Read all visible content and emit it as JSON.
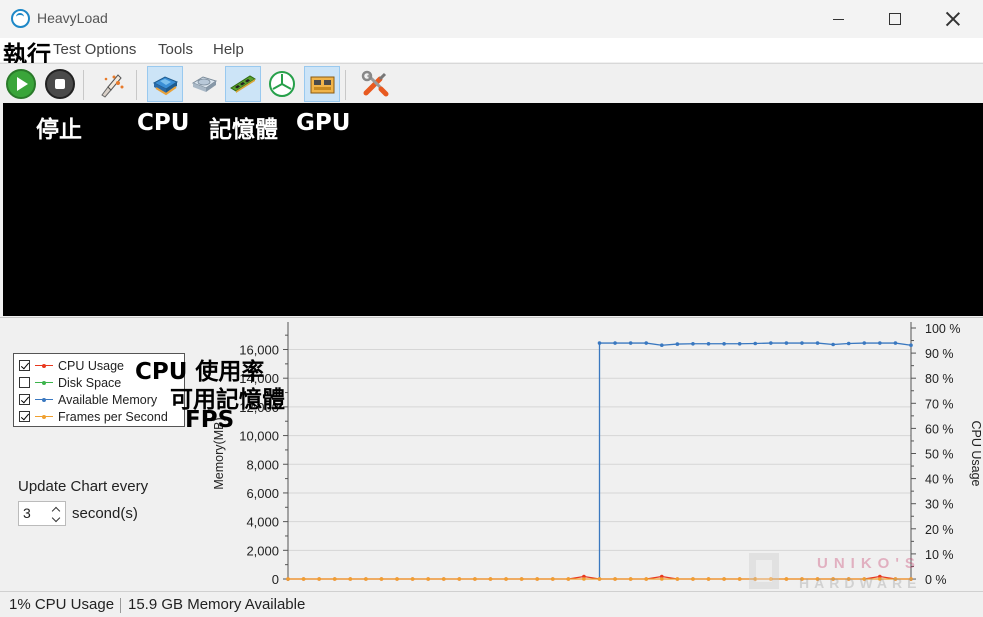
{
  "window": {
    "title": "HeavyLoad"
  },
  "menu": {
    "items": [
      "Test Options",
      "Tools",
      "Help"
    ]
  },
  "annotations": {
    "run": "執行",
    "stop": "停止",
    "cpu": "CPU",
    "memory": "記憶體",
    "gpu": "GPU",
    "cpu_usage": "CPU 使用率",
    "available_memory": "可用記憶體",
    "fps": "FPS"
  },
  "toolbar": {
    "buttons": [
      {
        "name": "start-icon",
        "state": "normal"
      },
      {
        "name": "stop-icon",
        "state": "normal"
      },
      {
        "name": "brush-icon",
        "state": "normal"
      },
      {
        "name": "cpu-chip-icon",
        "state": "active"
      },
      {
        "name": "disk-drive-icon",
        "state": "normal"
      },
      {
        "name": "memory-module-icon",
        "state": "active"
      },
      {
        "name": "pie-chart-icon",
        "state": "normal"
      },
      {
        "name": "gpu-card-icon",
        "state": "active"
      },
      {
        "name": "tools-icon",
        "state": "normal"
      }
    ]
  },
  "legend": {
    "items": [
      {
        "label": "CPU Usage",
        "checked": true,
        "color": "#e8391f"
      },
      {
        "label": "Disk Space",
        "checked": false,
        "color": "#3cb44b"
      },
      {
        "label": "Available Memory",
        "checked": true,
        "color": "#3a78c0"
      },
      {
        "label": "Frames per Second",
        "checked": true,
        "color": "#f0a030"
      }
    ]
  },
  "update": {
    "label": "Update Chart every",
    "value": "3",
    "unit": "second(s)"
  },
  "chart_data": {
    "type": "line",
    "left_axis": {
      "label": "Memory(MB)",
      "ticks": [
        "0",
        "2,000",
        "4,000",
        "6,000",
        "8,000",
        "10,000",
        "12,000",
        "14,000",
        "16,000"
      ],
      "range": [
        0,
        17500
      ]
    },
    "right_axis": {
      "label": "CPU Usage",
      "ticks": [
        "0 %",
        "10 %",
        "20 %",
        "30 %",
        "40 %",
        "50 %",
        "60 %",
        "70 %",
        "80 %",
        "90 %",
        "100 %"
      ],
      "range": [
        0,
        100
      ]
    },
    "grid": true,
    "legend_position": "top-left",
    "series": [
      {
        "name": "Available Memory",
        "color": "#3a78c0",
        "axis": "left",
        "x": [
          20,
          21,
          22,
          23,
          24,
          25,
          26,
          27,
          28,
          29,
          30,
          31,
          32,
          33,
          34,
          35,
          36,
          37,
          38,
          39,
          40
        ],
        "values": [
          16450,
          16450,
          16450,
          16450,
          16300,
          16380,
          16400,
          16400,
          16400,
          16400,
          16420,
          16450,
          16450,
          16450,
          16450,
          16350,
          16420,
          16450,
          16450,
          16450,
          16300
        ]
      },
      {
        "name": "CPU Usage",
        "color": "#e8391f",
        "axis": "right",
        "x": [
          0,
          1,
          2,
          3,
          4,
          5,
          6,
          7,
          8,
          9,
          10,
          11,
          12,
          13,
          14,
          15,
          16,
          17,
          18,
          19,
          20,
          21,
          22,
          23,
          24,
          25,
          26,
          27,
          28,
          29,
          30,
          31,
          32,
          33,
          34,
          35,
          36,
          37,
          38,
          39,
          40
        ],
        "values": [
          0,
          0,
          0,
          0,
          0,
          0,
          0,
          0,
          0,
          0,
          0,
          0,
          0,
          0,
          0,
          0,
          0,
          0,
          0,
          1,
          0,
          0,
          0,
          0,
          1,
          0,
          0,
          0,
          0,
          0,
          0,
          0,
          0,
          0,
          0,
          0,
          0,
          0,
          1,
          0,
          0
        ]
      },
      {
        "name": "Frames per Second",
        "color": "#f0a030",
        "axis": "right",
        "x": [
          0,
          1,
          2,
          3,
          4,
          5,
          6,
          7,
          8,
          9,
          10,
          11,
          12,
          13,
          14,
          15,
          16,
          17,
          18,
          19,
          20,
          21,
          22,
          23,
          24,
          25,
          26,
          27,
          28,
          29,
          30,
          31,
          32,
          33,
          34,
          35,
          36,
          37,
          38,
          39,
          40
        ],
        "values": [
          0,
          0,
          0,
          0,
          0,
          0,
          0,
          0,
          0,
          0,
          0,
          0,
          0,
          0,
          0,
          0,
          0,
          0,
          0,
          0,
          0,
          0,
          0,
          0,
          0,
          0,
          0,
          0,
          0,
          0,
          0,
          0,
          0,
          0,
          0,
          0,
          0,
          0,
          0,
          0,
          0
        ]
      }
    ],
    "x_range": [
      0,
      40
    ],
    "memory_start_index": 20
  },
  "status": {
    "cpu": "1% CPU Usage",
    "memory": "15.9 GB Memory Available"
  },
  "watermark": {
    "line1": "UNIKO'S",
    "line2": "HARDWARE"
  }
}
